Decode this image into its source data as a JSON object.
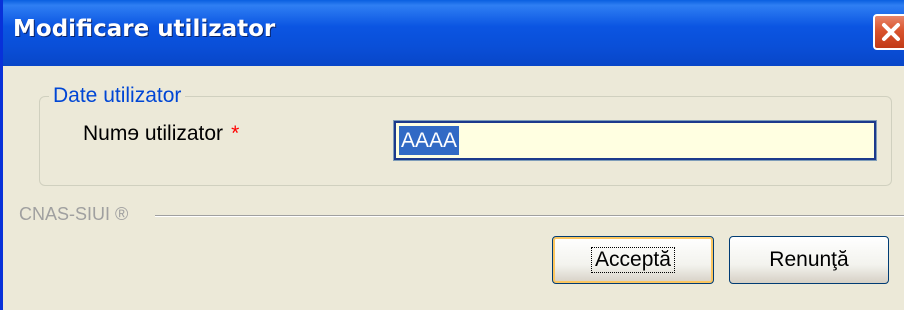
{
  "window": {
    "title": "Modificare utilizator"
  },
  "group": {
    "legend": "Date utilizator",
    "field_label": "Numɘ utilizator",
    "required_marker": "*",
    "field_value": "AAAA"
  },
  "separator": {
    "label": "CNAS-SIUI ®"
  },
  "buttons": {
    "accept": "Acceptă",
    "cancel": "Renunţă"
  },
  "colors": {
    "titlebar": "#0a4fd8",
    "window_bg": "#ece9d8",
    "legend_text": "#0046d5",
    "required": "#ff0000",
    "input_bg": "#ffffe1",
    "selection": "#316ac5"
  },
  "icons": {
    "close": "close-icon"
  }
}
